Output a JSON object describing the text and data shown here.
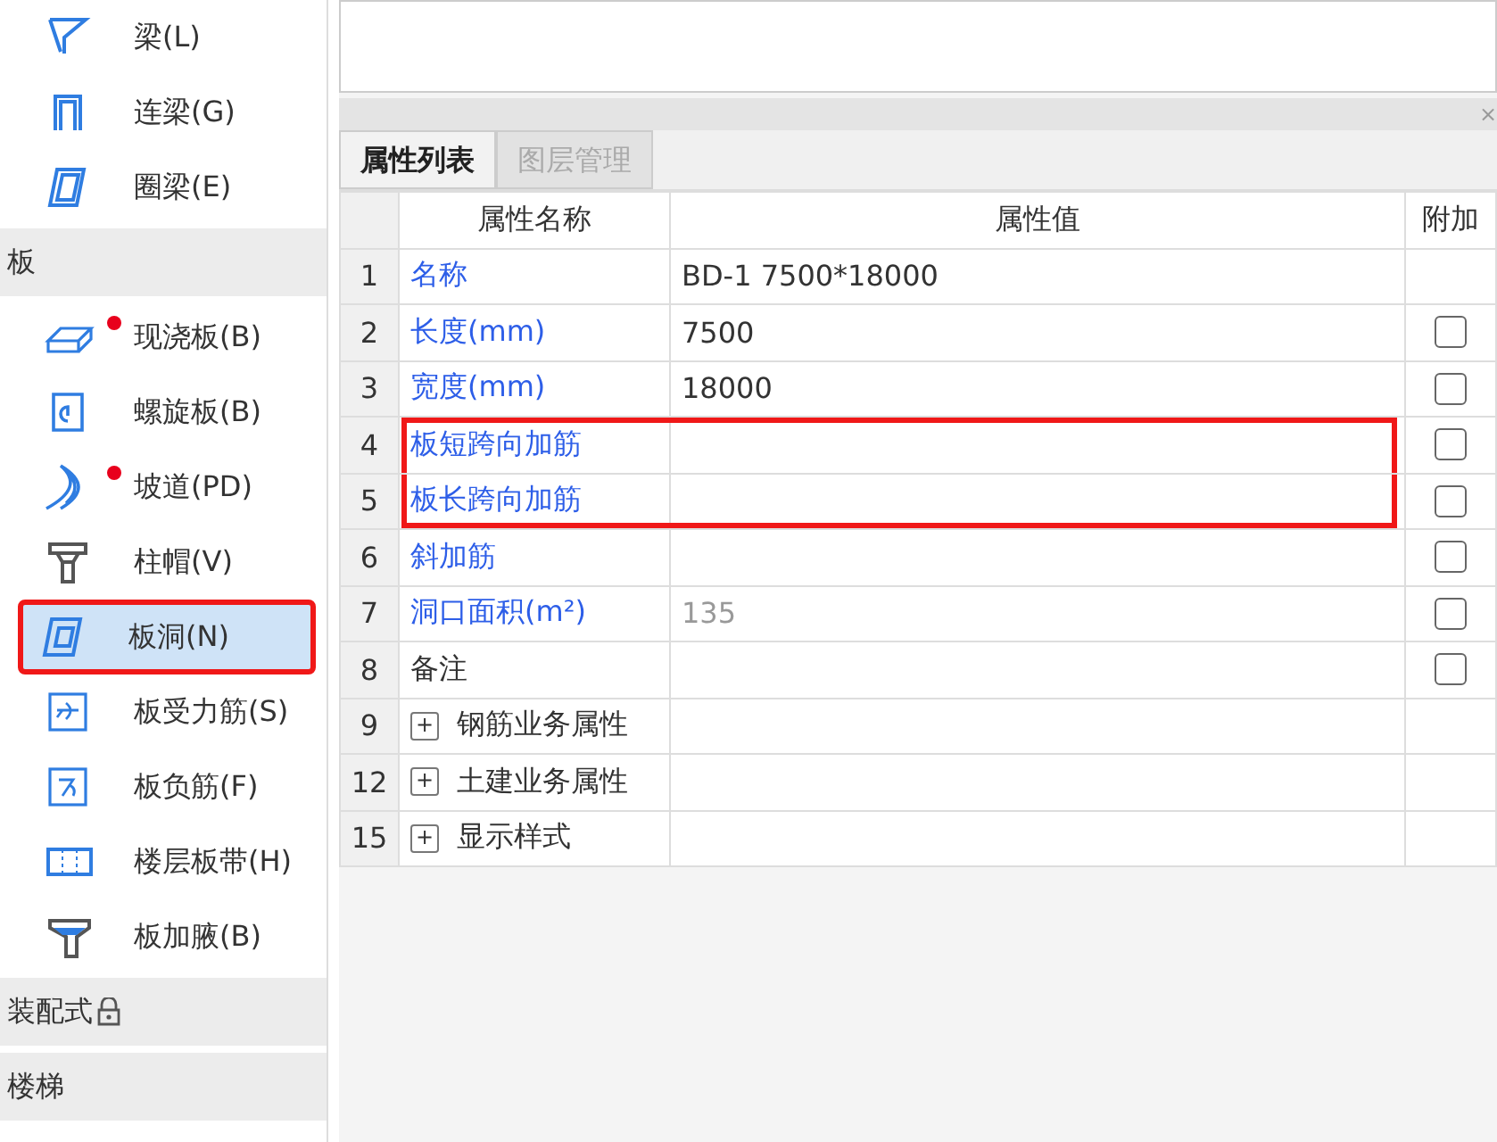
{
  "sidebar": [
    {
      "kind": "item",
      "label": "梁(L)",
      "dot": false,
      "selected": false,
      "highlighted": false
    },
    {
      "kind": "item",
      "label": "连梁(G)",
      "dot": false,
      "selected": false,
      "highlighted": false
    },
    {
      "kind": "item",
      "label": "圈梁(E)",
      "dot": false,
      "selected": false,
      "highlighted": false
    },
    {
      "kind": "header",
      "label": "板",
      "locked": false
    },
    {
      "kind": "item",
      "label": "现浇板(B)",
      "dot": true,
      "selected": false,
      "highlighted": false
    },
    {
      "kind": "item",
      "label": "螺旋板(B)",
      "dot": false,
      "selected": false,
      "highlighted": false
    },
    {
      "kind": "item",
      "label": "坡道(PD)",
      "dot": true,
      "selected": false,
      "highlighted": false
    },
    {
      "kind": "item",
      "label": "柱帽(V)",
      "dot": false,
      "selected": false,
      "highlighted": false
    },
    {
      "kind": "item",
      "label": "板洞(N)",
      "dot": false,
      "selected": true,
      "highlighted": true
    },
    {
      "kind": "item",
      "label": "板受力筋(S)",
      "dot": false,
      "selected": false,
      "highlighted": false
    },
    {
      "kind": "item",
      "label": "板负筋(F)",
      "dot": false,
      "selected": false,
      "highlighted": false
    },
    {
      "kind": "item",
      "label": "楼层板带(H)",
      "dot": false,
      "selected": false,
      "highlighted": false
    },
    {
      "kind": "item",
      "label": "板加腋(B)",
      "dot": false,
      "selected": false,
      "highlighted": false
    },
    {
      "kind": "header",
      "label": "装配式",
      "locked": true
    },
    {
      "kind": "header",
      "label": "楼梯",
      "locked": false
    }
  ],
  "panel": {
    "close": "×",
    "tabs": [
      {
        "label": "属性列表",
        "selected": true
      },
      {
        "label": "图层管理",
        "selected": false
      }
    ],
    "table": {
      "columns": [
        "属性名称",
        "属性值",
        "附加"
      ],
      "rows": [
        {
          "kind": "property",
          "index": "1",
          "name": "名称",
          "accent": true,
          "value": "BD-1 7500*18000",
          "dimmed": false,
          "highlighted": false
        },
        {
          "kind": "property",
          "index": "2",
          "name": "长度(mm)",
          "accent": true,
          "value": "7500",
          "dimmed": false,
          "checked": false,
          "highlighted": false
        },
        {
          "kind": "property",
          "index": "3",
          "name": "宽度(mm)",
          "accent": true,
          "value": "18000",
          "dimmed": false,
          "checked": false,
          "highlighted": false
        },
        {
          "kind": "property",
          "index": "4",
          "name": "板短跨向加筋",
          "accent": true,
          "checked": false,
          "highlighted": true
        },
        {
          "kind": "property",
          "index": "5",
          "name": "板长跨向加筋",
          "accent": true,
          "checked": false,
          "highlighted": true
        },
        {
          "kind": "property",
          "index": "6",
          "name": "斜加筋",
          "accent": true,
          "checked": false,
          "highlighted": false
        },
        {
          "kind": "property",
          "index": "7",
          "name": "洞口面积(m²)",
          "accent": true,
          "value": "135",
          "dimmed": true,
          "checked": false,
          "highlighted": false
        },
        {
          "kind": "property",
          "index": "8",
          "name": "备注",
          "accent": false,
          "checked": false,
          "highlighted": false
        },
        {
          "kind": "group",
          "index": "9",
          "name": "钢筋业务属性",
          "expander": "+",
          "expanded": false
        },
        {
          "kind": "group",
          "index": "12",
          "name": "土建业务属性",
          "expander": "+",
          "expanded": false
        },
        {
          "kind": "group",
          "index": "15",
          "name": "显示样式",
          "expander": "+",
          "expanded": false
        }
      ]
    }
  }
}
